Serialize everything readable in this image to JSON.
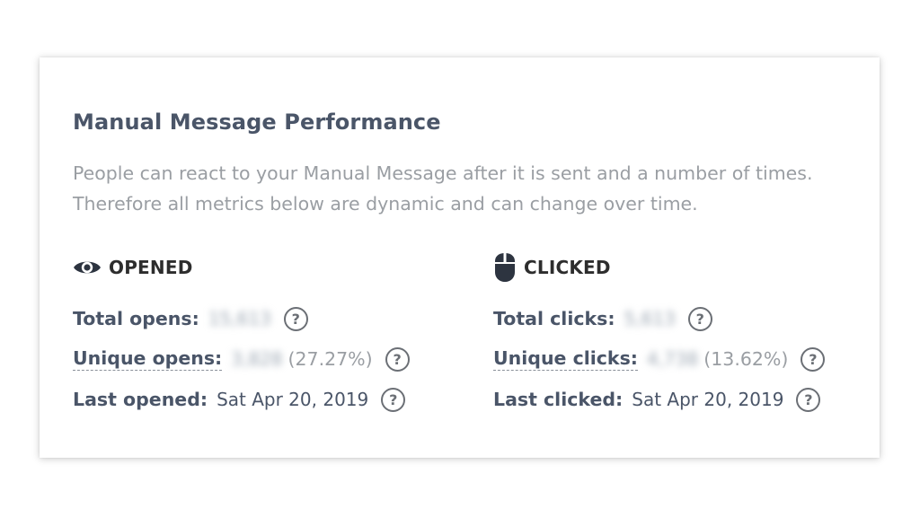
{
  "title": "Manual Message Performance",
  "description": {
    "line1": "People can react to your Manual Message after it is sent and a number of times.",
    "line2": "Therefore all metrics below are dynamic and can change over time."
  },
  "opened": {
    "heading": "OPENED",
    "icon": "eye-icon",
    "total_label": "Total opens:",
    "total_value": "15,613",
    "unique_label": "Unique opens:",
    "unique_value": "3,828",
    "unique_pct": "(27.27%)",
    "last_label": "Last opened:",
    "last_value": "Sat Apr 20, 2019"
  },
  "clicked": {
    "heading": "CLICKED",
    "icon": "mouse-icon",
    "total_label": "Total clicks:",
    "total_value": "5,613",
    "unique_label": "Unique clicks:",
    "unique_value": "4,738",
    "unique_pct": "(13.62%)",
    "last_label": "Last clicked:",
    "last_value": "Sat Apr 20, 2019"
  },
  "help_glyph": "?",
  "colors": {
    "heading": "#4a5568",
    "muted": "#9a9ea3",
    "icon": "#2d3440"
  }
}
